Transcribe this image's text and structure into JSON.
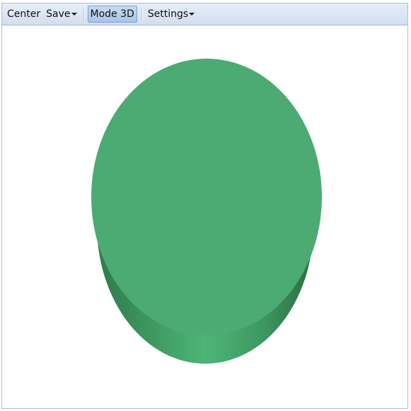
{
  "toolbar": {
    "center_label": "Center",
    "save_label": "Save",
    "mode_label": "Mode 3D",
    "settings_label": "Settings"
  },
  "viewport": {
    "object": "cylinder",
    "colors": {
      "top_face": "#4bab72",
      "side_light": "#4db577",
      "side_dark": "#2e7648",
      "background": "#ffffff"
    }
  }
}
